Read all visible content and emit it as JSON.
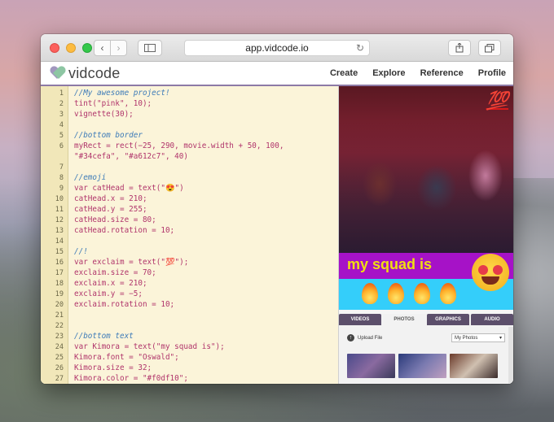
{
  "browser": {
    "url": "app.vidcode.io"
  },
  "app": {
    "logo_vid": "vid",
    "logo_code": "code",
    "nav": [
      "Create",
      "Explore",
      "Reference",
      "Profile"
    ]
  },
  "editor": {
    "lines": [
      {
        "n": "1",
        "text": "//My awesome project!",
        "kind": "comment"
      },
      {
        "n": "2",
        "text": "tint(\"pink\", 10);",
        "kind": "code"
      },
      {
        "n": "3",
        "text": "vignette(30);",
        "kind": "code"
      },
      {
        "n": "4",
        "text": "",
        "kind": "code"
      },
      {
        "n": "5",
        "text": "//bottom border",
        "kind": "comment"
      },
      {
        "n": "6",
        "text": "myRect = rect(−25, 290, movie.width + 50, 100,",
        "kind": "code"
      },
      {
        "n": "",
        "text": "\"#34cefa\", \"#a612c7\", 40)",
        "kind": "code"
      },
      {
        "n": "7",
        "text": "",
        "kind": "code"
      },
      {
        "n": "8",
        "text": "//emoji",
        "kind": "comment"
      },
      {
        "n": "9",
        "text": "var catHead = text(\"😍\")",
        "kind": "code"
      },
      {
        "n": "10",
        "text": "catHead.x = 210;",
        "kind": "code"
      },
      {
        "n": "11",
        "text": "catHead.y = 255;",
        "kind": "code"
      },
      {
        "n": "12",
        "text": "catHead.size = 80;",
        "kind": "code"
      },
      {
        "n": "13",
        "text": "catHead.rotation = 10;",
        "kind": "code"
      },
      {
        "n": "14",
        "text": "",
        "kind": "code"
      },
      {
        "n": "15",
        "text": "//!",
        "kind": "comment"
      },
      {
        "n": "16",
        "text": "var exclaim = text(\"💯\");",
        "kind": "code"
      },
      {
        "n": "17",
        "text": "exclaim.size = 70;",
        "kind": "code"
      },
      {
        "n": "18",
        "text": "exclaim.x = 210;",
        "kind": "code"
      },
      {
        "n": "19",
        "text": "exclaim.y = −5;",
        "kind": "code"
      },
      {
        "n": "20",
        "text": "exclaim.rotation = 10;",
        "kind": "code"
      },
      {
        "n": "21",
        "text": "",
        "kind": "code"
      },
      {
        "n": "22",
        "text": "",
        "kind": "code"
      },
      {
        "n": "23",
        "text": "//bottom text",
        "kind": "comment"
      },
      {
        "n": "24",
        "text": "var Kimora = text(\"my squad is\");",
        "kind": "code"
      },
      {
        "n": "25",
        "text": "Kimora.font = \"Oswald\";",
        "kind": "code"
      },
      {
        "n": "26",
        "text": "Kimora.size = 32;",
        "kind": "code"
      },
      {
        "n": "27",
        "text": "Kimora.color = \"#f0df10\";",
        "kind": "code"
      }
    ]
  },
  "preview": {
    "overlay_text": "my squad is",
    "emoji_100": "💯"
  },
  "media": {
    "tabs": [
      "VIDEOS",
      "PHOTOS",
      "GRAPHICS",
      "AUDIO"
    ],
    "active_tab": "PHOTOS",
    "upload_label": "Upload File",
    "source_select": "My Photos"
  },
  "colors": {
    "banner_purple": "#a612c7",
    "banner_blue": "#34cefa",
    "text_yellow": "#f0df10"
  }
}
